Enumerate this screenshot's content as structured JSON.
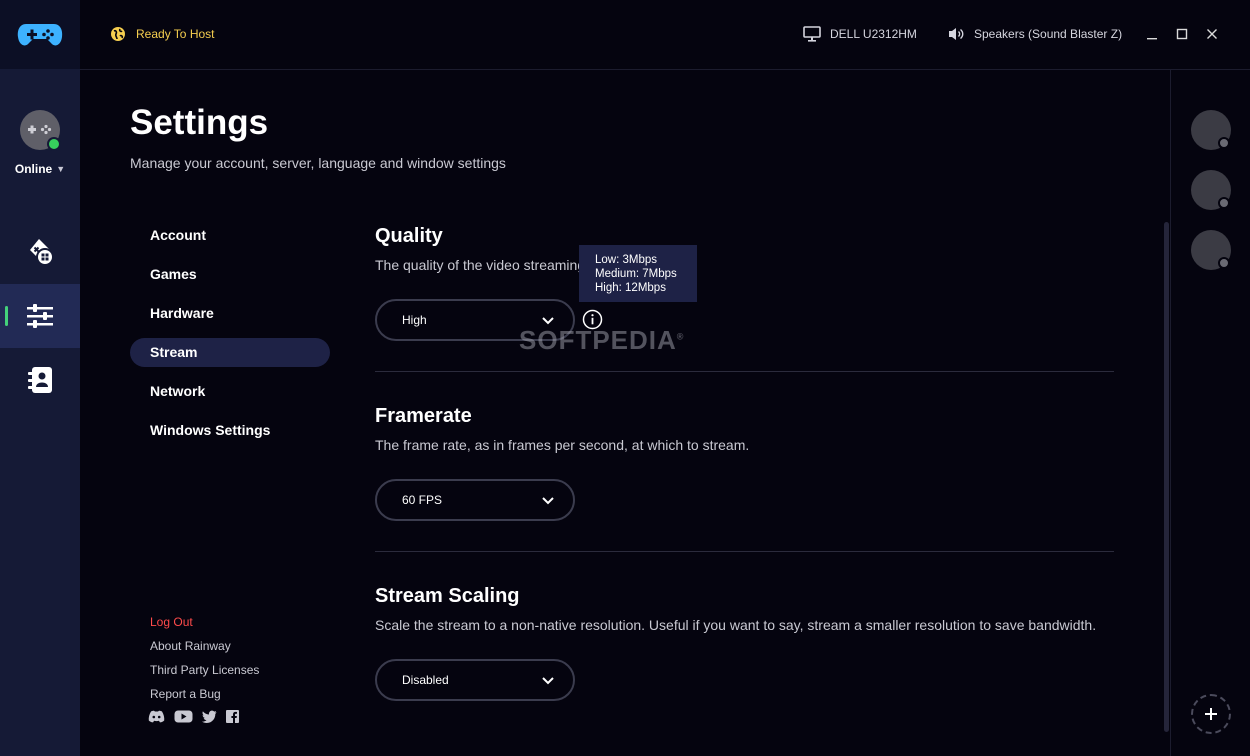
{
  "titlebar": {
    "host_status": "Ready To Host",
    "display": "DELL U2312HM",
    "audio": "Speakers (Sound Blaster Z)"
  },
  "user": {
    "status": "Online"
  },
  "page": {
    "title": "Settings",
    "subtitle": "Manage your account, server, language and window settings"
  },
  "nav": {
    "items": [
      "Account",
      "Games",
      "Hardware",
      "Stream",
      "Network",
      "Windows Settings"
    ],
    "active": "Stream"
  },
  "footer": {
    "logout": "Log Out",
    "about": "About Rainway",
    "licenses": "Third Party Licenses",
    "report": "Report a Bug"
  },
  "quality": {
    "title": "Quality",
    "description": "The quality of the video streaming",
    "value": "High",
    "tooltip": [
      "Low: 3Mbps",
      "Medium: 7Mbps",
      "High: 12Mbps"
    ]
  },
  "framerate": {
    "title": "Framerate",
    "description": "The frame rate, as in frames per second, at which to stream.",
    "value": "60 FPS"
  },
  "scaling": {
    "title": "Stream Scaling",
    "description": "Scale the stream to a non-native resolution. Useful if you want to say, stream a smaller resolution to save bandwidth.",
    "value": "Disabled"
  },
  "watermark": "SOFTPEDIA",
  "watermark_mark": "®",
  "colors": {
    "accent_yellow": "#f5ce4f",
    "online_green": "#37d05d",
    "logout_red": "#ff4b4b",
    "brand_blue": "#3db2ff",
    "rail_bg": "#151a36",
    "active_bg": "#1e2246"
  }
}
